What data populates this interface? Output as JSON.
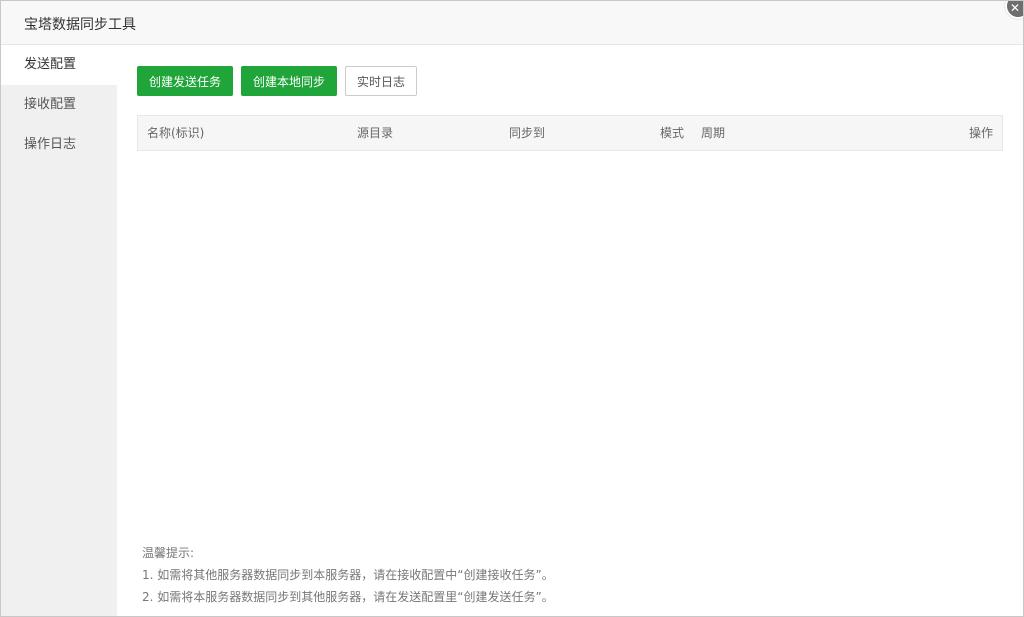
{
  "window": {
    "title": "宝塔数据同步工具",
    "close_symbol": "✕"
  },
  "sidebar": {
    "items": [
      {
        "label": "发送配置",
        "active": true
      },
      {
        "label": "接收配置",
        "active": false
      },
      {
        "label": "操作日志",
        "active": false
      }
    ]
  },
  "toolbar": {
    "create_send_task": "创建发送任务",
    "create_local_sync": "创建本地同步",
    "realtime_log": "实时日志"
  },
  "table": {
    "columns": [
      "名称(标识)",
      "源目录",
      "同步到",
      "模式",
      "周期",
      "操作"
    ]
  },
  "tips": {
    "heading": "温馨提示:",
    "line1": "1. 如需将其他服务器数据同步到本服务器，请在接收配置中“创建接收任务”。",
    "line2": "2. 如需将本服务器数据同步到其他服务器，请在发送配置里“创建发送任务”。"
  },
  "colors": {
    "accent": "#20a53a",
    "sidebar_bg": "#f0f0f0",
    "header_bg": "#f6f6f6"
  }
}
